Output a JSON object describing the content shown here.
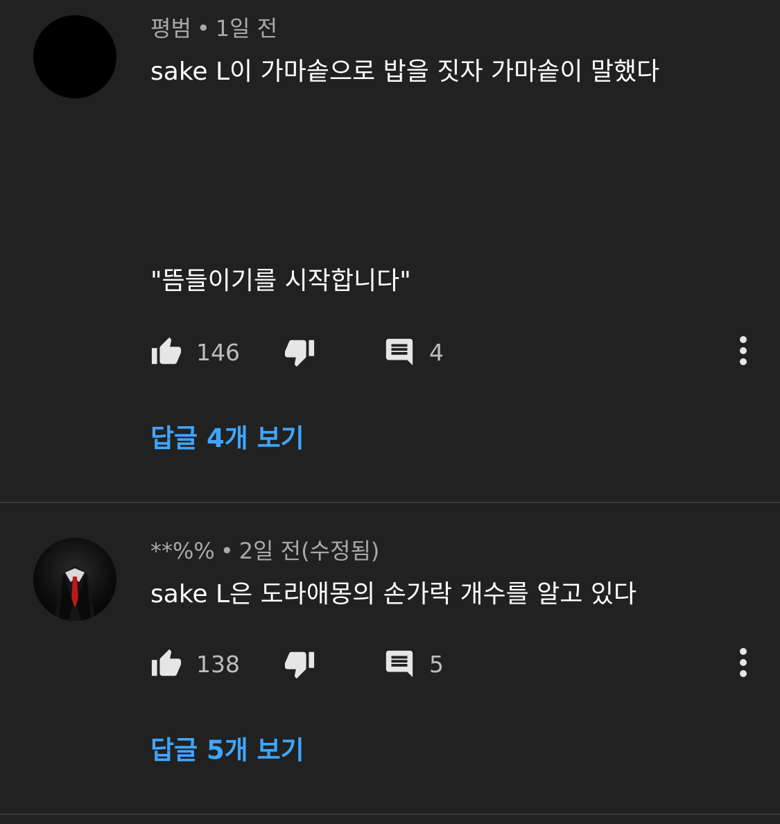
{
  "comments": [
    {
      "author": "평범",
      "separator": "•",
      "time": "1일 전",
      "text_line1": "sake L이 가마솥으로 밥을 짓자 가마솥이 말했다",
      "text_line2": "\"뜸들이기를 시작합니다\"",
      "likes": "146",
      "reply_count": "4",
      "view_replies": "답글 4개 보기",
      "avatar_icon": "black-circle-avatar"
    },
    {
      "author": "**%%",
      "separator": "•",
      "time": "2일 전(수정됨)",
      "text_line1": "sake L은 도라애몽의 손가락 개수를 알고 있다",
      "likes": "138",
      "reply_count": "5",
      "view_replies": "답글 5개 보기",
      "avatar_icon": "suit-avatar"
    }
  ],
  "icons": {
    "like": "thumbs-up-icon",
    "dislike": "thumbs-down-icon",
    "reply": "comment-icon",
    "more": "more-vert-icon"
  },
  "colors": {
    "background": "#212121",
    "link": "#3ea6ff",
    "meta": "#a9a9a9",
    "divider": "#3a3a3a"
  }
}
